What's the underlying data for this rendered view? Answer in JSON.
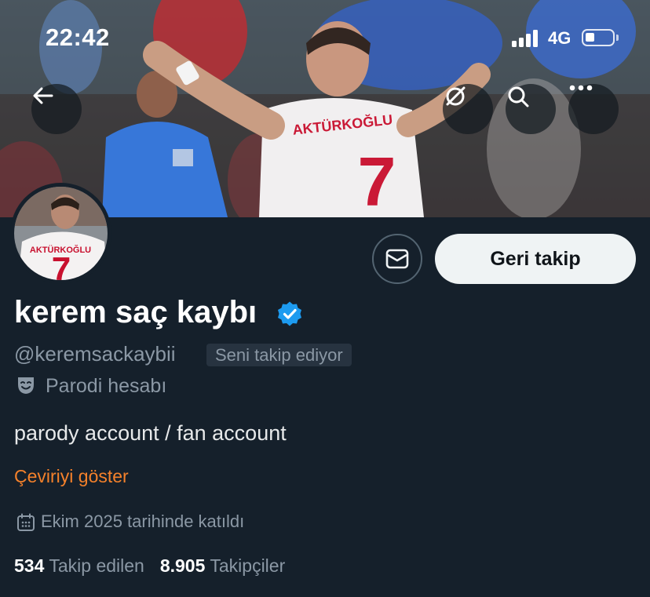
{
  "status_bar": {
    "time": "22:42",
    "network": "4G",
    "signal_bars": 4,
    "battery_level": 0.25
  },
  "banner": {
    "jersey_name": "AKTÜRKOĞLU",
    "jersey_number": "7",
    "buttons": [
      {
        "icon": "back-arrow-icon"
      },
      {
        "icon": "grok-icon"
      },
      {
        "icon": "search-icon"
      },
      {
        "icon": "more-icon"
      }
    ]
  },
  "avatar": {
    "jersey_name": "AKTÜRKOĞLU",
    "jersey_number": "7"
  },
  "actions": {
    "follow_back_label": "Geri takip",
    "message_icon": "mail-icon"
  },
  "profile": {
    "display_name": "kerem saç kaybı",
    "verified": true,
    "handle": "@keremsackaybii",
    "follows_you": "Seni takip ediyor",
    "parody_label": "Parodi hesabı",
    "bio": "parody account / fan account",
    "translate_label": "Çeviriyi göster",
    "joined": "Ekim 2025 tarihinde katıldı"
  },
  "stats": {
    "following_count": "534",
    "following_label": "Takip edilen",
    "followers_count": "8.905",
    "followers_label": "Takipçiler"
  },
  "colors": {
    "background": "#15202b",
    "accent_orange": "#f4812b",
    "verified_blue": "#1d9bf0",
    "muted_text": "#8b98a5",
    "jersey_red": "#c8102e"
  }
}
